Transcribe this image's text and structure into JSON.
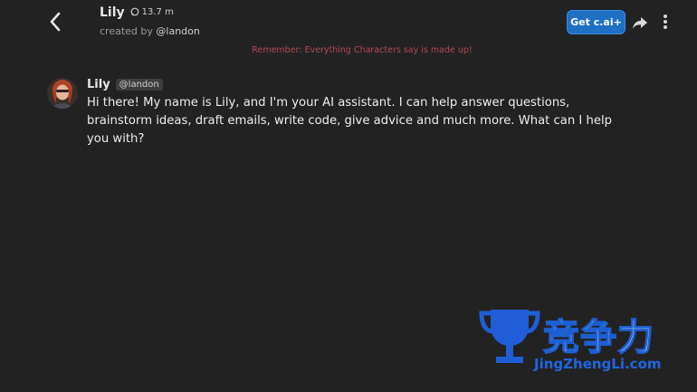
{
  "header": {
    "character_name": "Lily",
    "interaction_count": "13.7 m",
    "created_by_prefix": "created by",
    "creator_handle": "@landon",
    "get_plus_label": "Get c.ai+"
  },
  "reminder": "Remember: Everything Characters say is made up!",
  "message": {
    "author": "Lily",
    "author_handle": "@landon",
    "text": "Hi there! My name is Lily, and I'm your AI assistant. I can help answer questions, brainstorm ideas, draft emails, write code, give advice and much more. What can I help you with?"
  },
  "watermark": {
    "cn_text": "竞争力",
    "url": "JingZhengLi.com"
  },
  "colors": {
    "background": "#222223",
    "accent_button": "#1f6fc5",
    "reminder": "#b04a52"
  },
  "icons": [
    "back-arrow-icon",
    "chat-bubble-icon",
    "share-icon",
    "more-vertical-icon",
    "trophy-icon"
  ]
}
